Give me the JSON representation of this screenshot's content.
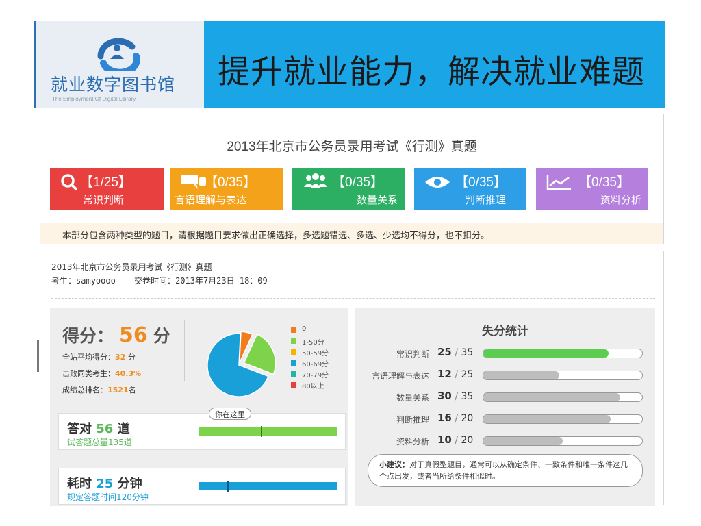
{
  "header": {
    "logo_name": "就业数字图书馆",
    "logo_subtitle": "The Employment Of Digital Library",
    "slogan": "提升就业能力，解决就业难题"
  },
  "exam": {
    "title": "2013年北京市公务员录用考试《行测》真题",
    "categories": [
      {
        "count": "【1/25】",
        "label": "常识判断",
        "color": "#e8403f",
        "icon": "search-icon"
      },
      {
        "count": "【0/35】",
        "label": "言语理解与表达",
        "color": "#f5a21b",
        "icon": "chat-icon"
      },
      {
        "count": "【0/35】",
        "label": "数量关系",
        "color": "#2daf63",
        "icon": "people-icon"
      },
      {
        "count": "【0/35】",
        "label": "判断推理",
        "color": "#2e9ee6",
        "icon": "eye-icon"
      },
      {
        "count": "【0/35】",
        "label": "资料分析",
        "color": "#b57fde",
        "icon": "line-chart-icon"
      }
    ],
    "notice": "本部分包含两种类型的题目，请根据题目要求做出正确选择，多选题错选、多选、少选均不得分，也不扣分。"
  },
  "result": {
    "title": "2013年北京市公务员录用考试《行测》真题",
    "candidate_label": "考生：",
    "candidate": "samyoooo",
    "submit_label": "交卷时间：",
    "submit_time": "2013年7月23日 18：09",
    "score_label": "得分：",
    "score": "56",
    "score_unit": "分",
    "avg_label": "全站平均得分：",
    "avg": "32",
    "avg_unit": "分",
    "beat_label": "击败同类考生：",
    "beat": "40.3%",
    "rank_label": "成绩总排名：",
    "rank": "1521",
    "rank_unit": "名",
    "you_here": "你在这里",
    "correct_label": "答对",
    "correct": "56",
    "correct_unit": "道",
    "total_note": "试答题总量135道",
    "correct_marker": 0.45,
    "time_label": "耗时",
    "time": "25",
    "time_unit": "分钟",
    "time_note": "规定答题时间120分钟",
    "time_marker": 0.21
  },
  "chart_data": {
    "type": "pie",
    "categories": [
      "0",
      "1-50分",
      "50-59分",
      "60-69分",
      "70-79分",
      "80以上"
    ],
    "values": [
      0.06,
      0.24,
      0.0,
      0.7,
      0.0,
      0.0
    ],
    "colors": [
      "#f07c1e",
      "#7dd34a",
      "#f5b400",
      "#1aa0d9",
      "#25b5a4",
      "#e8403f"
    ]
  },
  "loss_stats": {
    "title": "失分统计",
    "rows": [
      {
        "label": "常识判断",
        "score": "25",
        "total": "35",
        "ratio": 0.79,
        "color": "#5ccd50"
      },
      {
        "label": "言语理解与表达",
        "score": "12",
        "total": "25",
        "ratio": 0.48,
        "color": "#bdbdbd"
      },
      {
        "label": "数量关系",
        "score": "30",
        "total": "35",
        "ratio": 0.86,
        "color": "#bdbdbd"
      },
      {
        "label": "判断推理",
        "score": "16",
        "total": "20",
        "ratio": 0.8,
        "color": "#bdbdbd"
      },
      {
        "label": "资料分析",
        "score": "10",
        "total": "20",
        "ratio": 0.5,
        "color": "#bdbdbd"
      }
    ],
    "tip_label": "小建议：",
    "tip_text": "对于真假型题目，通常可以从确定条件、一致条件和唯一条件这几个点出发，或者当所给条件相似时。"
  }
}
